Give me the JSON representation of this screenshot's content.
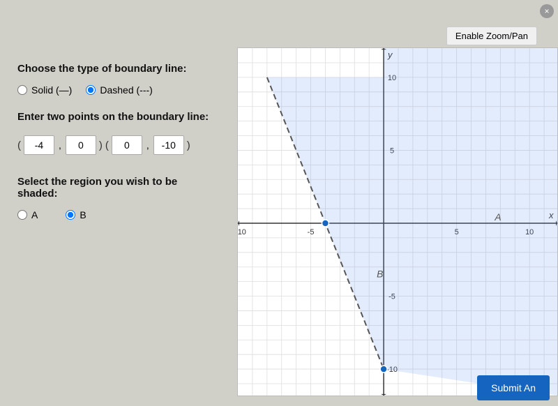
{
  "close_button": "×",
  "zoom_pan_label": "Enable Zoom/Pan",
  "boundary_section": {
    "title": "Choose the type of boundary line:",
    "options": [
      {
        "id": "solid",
        "label": "Solid (—)",
        "checked": false
      },
      {
        "id": "dashed",
        "label": "Dashed (---)",
        "checked": true
      }
    ]
  },
  "points_section": {
    "title": "Enter two points on the boundary line:",
    "point1": {
      "x": "-4",
      "y": "0"
    },
    "point2": {
      "x": "0",
      "y": "-10"
    }
  },
  "shade_section": {
    "title": "Select the region you wish to be shaded:",
    "options": [
      {
        "id": "shadeA",
        "label": "A",
        "checked": false
      },
      {
        "id": "shadeB",
        "label": "B",
        "checked": true
      }
    ]
  },
  "submit_label": "Submit An",
  "graph": {
    "axis_labels": {
      "x": "x",
      "y": "y"
    },
    "region_labels": {
      "A": "A",
      "B": "B"
    }
  }
}
